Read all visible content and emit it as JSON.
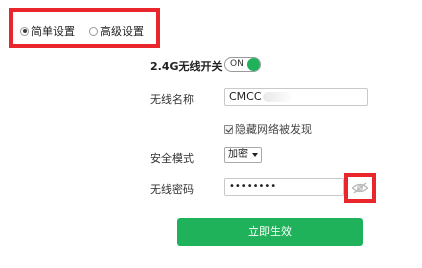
{
  "mode": {
    "options": [
      {
        "label": "简单设置",
        "selected": true
      },
      {
        "label": "高级设置",
        "selected": false
      }
    ]
  },
  "wifi_24g": {
    "label": "2.4G无线开关",
    "state": "ON",
    "accent": "#1fb25a"
  },
  "ssid": {
    "label": "无线名称",
    "value": "CMCC"
  },
  "hide_network": {
    "label": "隐藏网络被发现",
    "checked": true
  },
  "security": {
    "label": "安全模式",
    "selected": "加密"
  },
  "password": {
    "label": "无线密码",
    "value": "••••••••"
  },
  "submit": {
    "label": "立即生效",
    "color": "#1fb25a"
  },
  "highlight_color": "#e8262b",
  "icons": [
    "hide-password-eye-icon",
    "chevron-down-icon",
    "checkmark-icon"
  ]
}
